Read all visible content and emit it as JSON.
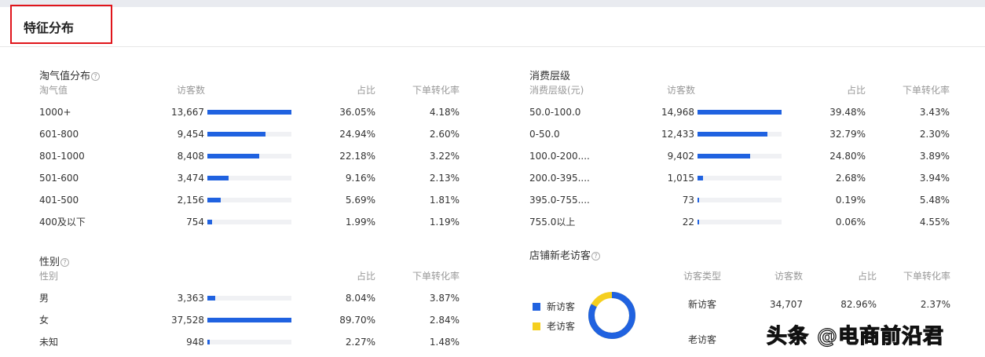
{
  "header": {
    "title": "特征分布"
  },
  "colors": {
    "bar": "#2062e0",
    "new": "#2062e0",
    "old": "#f5cf1f"
  },
  "taoqi": {
    "title": "淘气值分布",
    "headers": [
      "淘气值",
      "访客数",
      "占比",
      "下单转化率"
    ],
    "rows": [
      {
        "label": "1000+",
        "visitors": "13,667",
        "v": 13667,
        "share": "36.05%",
        "conv": "4.18%"
      },
      {
        "label": "601-800",
        "visitors": "9,454",
        "v": 9454,
        "share": "24.94%",
        "conv": "2.60%"
      },
      {
        "label": "801-1000",
        "visitors": "8,408",
        "v": 8408,
        "share": "22.18%",
        "conv": "3.22%"
      },
      {
        "label": "501-600",
        "visitors": "3,474",
        "v": 3474,
        "share": "9.16%",
        "conv": "2.13%"
      },
      {
        "label": "401-500",
        "visitors": "2,156",
        "v": 2156,
        "share": "5.69%",
        "conv": "1.81%"
      },
      {
        "label": "400及以下",
        "visitors": "754",
        "v": 754,
        "share": "1.99%",
        "conv": "1.19%"
      }
    ]
  },
  "consume": {
    "title": "消费层级",
    "headers": [
      "消费层级(元)",
      "访客数",
      "占比",
      "下单转化率"
    ],
    "rows": [
      {
        "label": "50.0-100.0",
        "visitors": "14,968",
        "v": 14968,
        "share": "39.48%",
        "conv": "3.43%"
      },
      {
        "label": "0-50.0",
        "visitors": "12,433",
        "v": 12433,
        "share": "32.79%",
        "conv": "2.30%"
      },
      {
        "label": "100.0-200....",
        "visitors": "9,402",
        "v": 9402,
        "share": "24.80%",
        "conv": "3.89%"
      },
      {
        "label": "200.0-395....",
        "visitors": "1,015",
        "v": 1015,
        "share": "2.68%",
        "conv": "3.94%"
      },
      {
        "label": "395.0-755....",
        "visitors": "73",
        "v": 73,
        "share": "0.19%",
        "conv": "5.48%"
      },
      {
        "label": "755.0以上",
        "visitors": "22",
        "v": 22,
        "share": "0.06%",
        "conv": "4.55%"
      }
    ]
  },
  "gender": {
    "title": "性别",
    "headers": [
      "性别",
      "",
      "占比",
      "下单转化率"
    ],
    "rows": [
      {
        "label": "男",
        "visitors": "3,363",
        "v": 3363,
        "share": "8.04%",
        "conv": "3.87%"
      },
      {
        "label": "女",
        "visitors": "37,528",
        "v": 37528,
        "share": "89.70%",
        "conv": "2.84%"
      },
      {
        "label": "未知",
        "visitors": "948",
        "v": 948,
        "share": "2.27%",
        "conv": "1.48%"
      }
    ]
  },
  "visitor": {
    "title": "店铺新老访客",
    "headers": [
      "访客类型",
      "访客数",
      "占比",
      "下单转化率"
    ],
    "legend": [
      "新访客",
      "老访客"
    ],
    "new_share": 82.96,
    "rows": [
      {
        "type": "新访客",
        "visitors": "34,707",
        "share": "82.96%",
        "conv": "2.37%"
      },
      {
        "type": "老访客"
      }
    ]
  },
  "watermark": "头条 @电商前沿君"
}
